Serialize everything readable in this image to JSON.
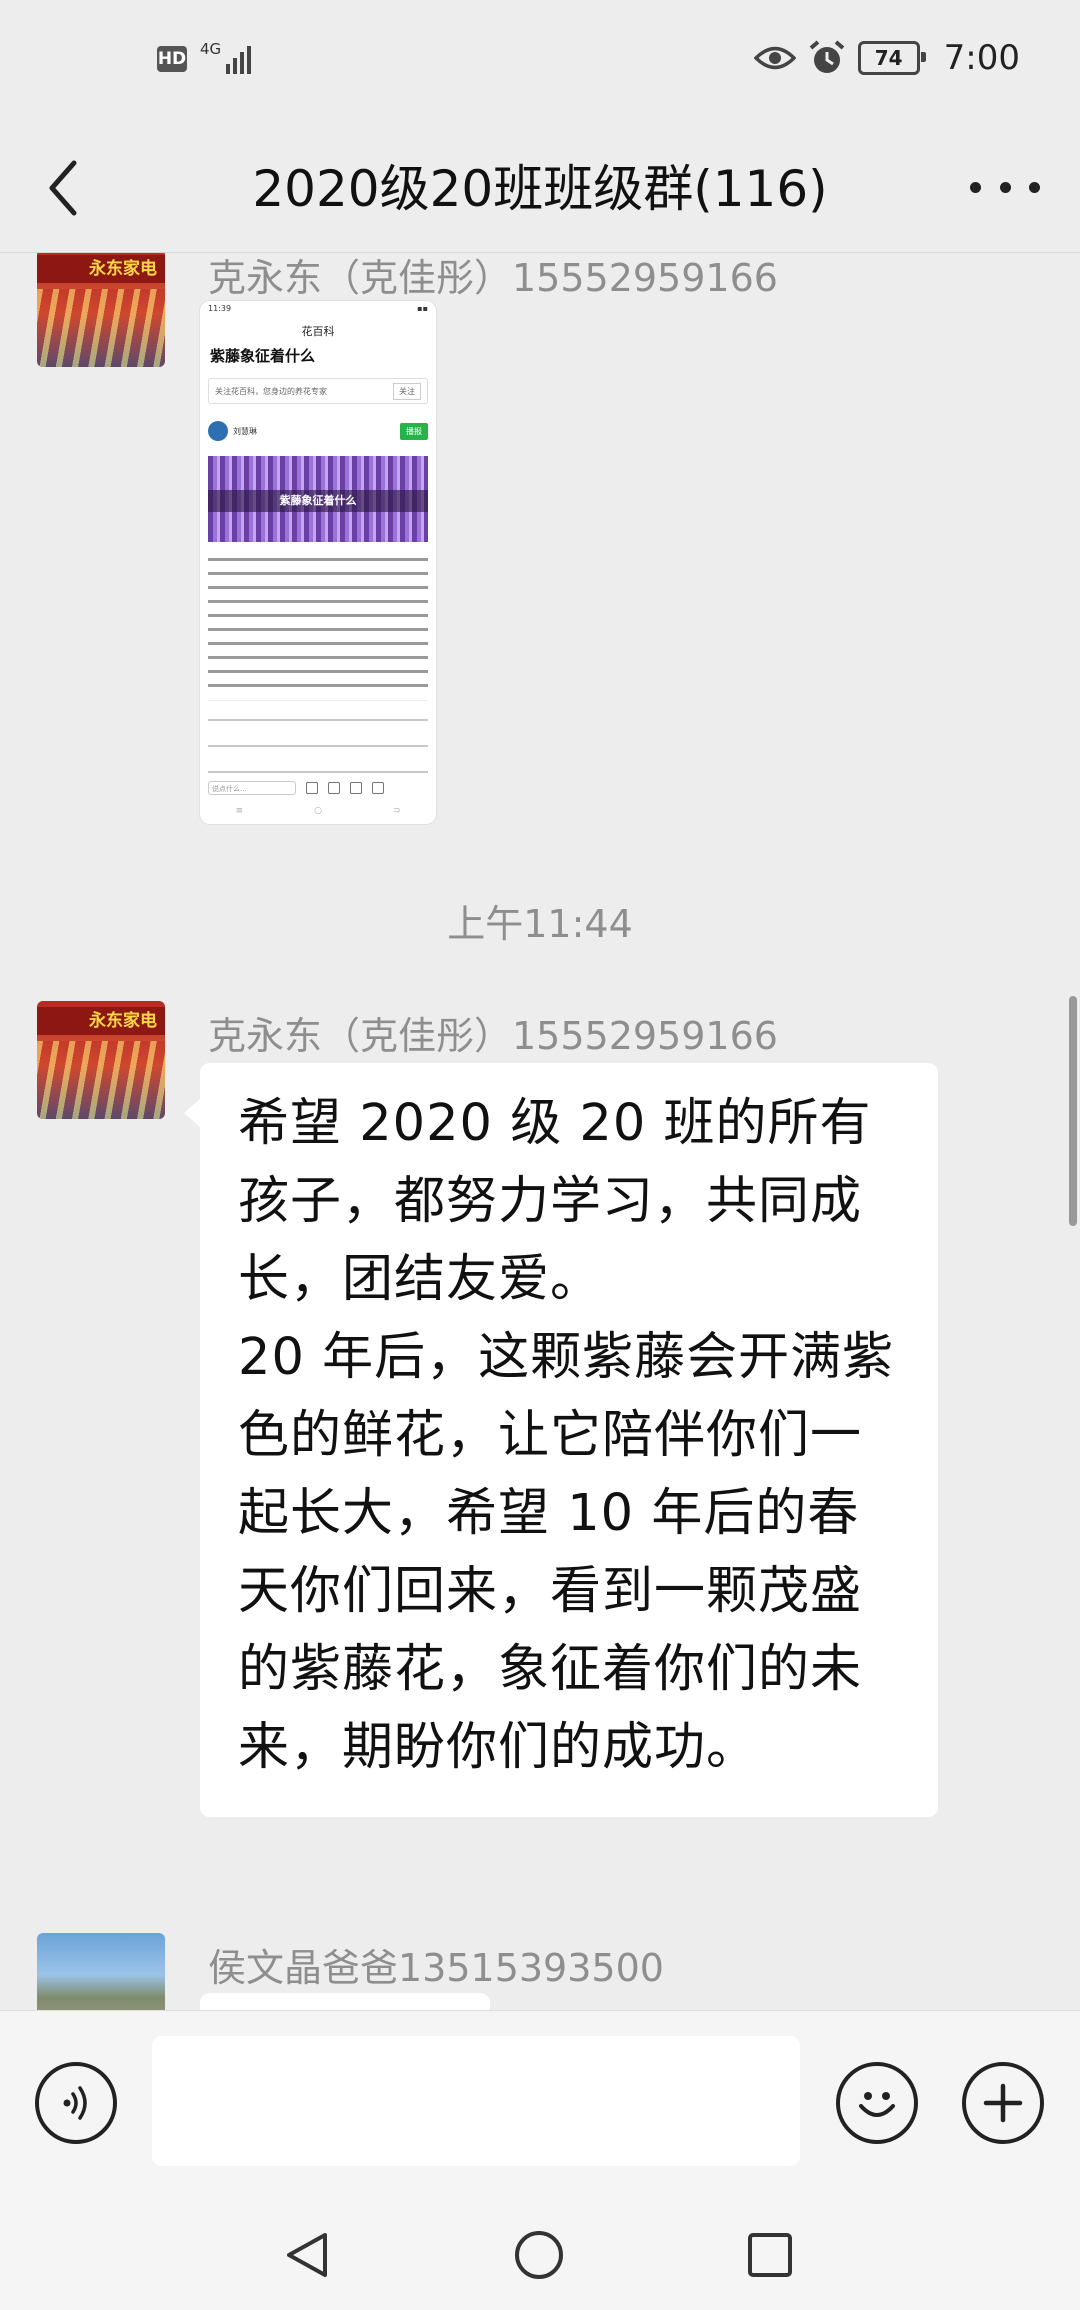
{
  "status_bar": {
    "hd": "HD",
    "network": "4G",
    "battery": "74",
    "time": "7:00"
  },
  "header": {
    "title": "2020级20班班级群(116)"
  },
  "messages": [
    {
      "sender": "克永东（克佳彤）15552959166",
      "type": "image",
      "card": {
        "status": "11:39",
        "nav_title": "花百科",
        "headline": "紫藤象征着什么",
        "follow_text": "关注花百科，您身边的养花专家",
        "follow_button": "关注",
        "author": "刘慧琳",
        "author_button": "播报",
        "banner_text": "紫藤象征着什么",
        "comment_placeholder": "说点什么..."
      }
    },
    {
      "type": "time",
      "text": "上午11:44"
    },
    {
      "sender": "克永东（克佳彤）15552959166",
      "type": "text",
      "paragraphs": [
        "希望 2020 级 20 班的所有孩子，都努力学习，共同成长，团结友爱。",
        "20 年后，这颗紫藤会开满紫色的鲜花，让它陪伴你们一起长大，希望 10 年后的春天你们回来，看到一颗茂盛的紫藤花，象征着你们的未来，期盼你们的成功。"
      ]
    },
    {
      "sender": "侯文晶爸爸13515393500",
      "type": "text"
    }
  ],
  "input_bar": {
    "voice_icon": "voice-icon",
    "emoji_icon": "emoji-icon",
    "plus_icon": "plus-icon",
    "text": ""
  },
  "colors": {
    "background": "#ededed",
    "bubble": "#ffffff",
    "muted_text": "#8e8e8e"
  }
}
